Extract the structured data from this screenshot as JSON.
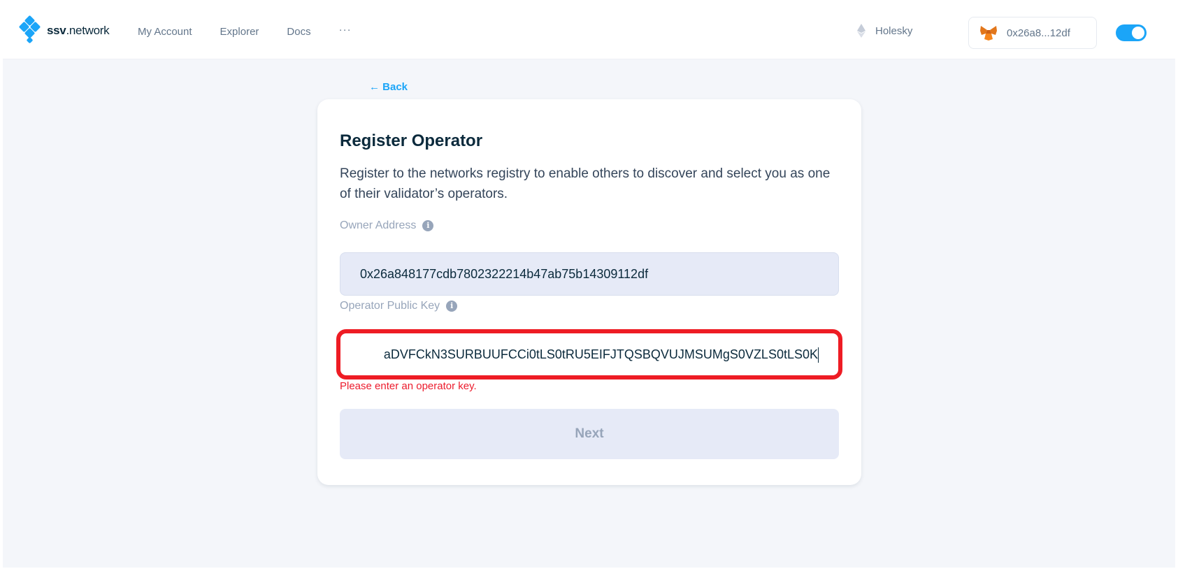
{
  "header": {
    "logo": {
      "bold": "ssv",
      "rest": ".network"
    },
    "nav": [
      "My Account",
      "Explorer",
      "Docs"
    ],
    "more": "···",
    "network": "Holesky",
    "wallet": "0x26a8...12df"
  },
  "page": {
    "back": "← Back",
    "title": "Register Operator",
    "description": "Register to the networks registry to enable others to discover and select you as one of their validator’s operators.",
    "owner_label": "Owner Address",
    "owner_value": "0x26a848177cdb7802322214b47ab75b14309112df",
    "key_label": "Operator Public Key",
    "key_value": "aDVFCkN3SURBUUFCCi0tLS0tRU5EIFJTQSBQVUJMSUMgS0VZLS0tLS0K",
    "error": "Please enter an operator key.",
    "next": "Next"
  },
  "colors": {
    "brand": "#1ba5f8",
    "error": "#ec1c2d",
    "highlight": "#ee1c24"
  },
  "icons": [
    "ssv-logo-icon",
    "ethereum-icon",
    "metamask-fox-icon",
    "info-icon"
  ]
}
